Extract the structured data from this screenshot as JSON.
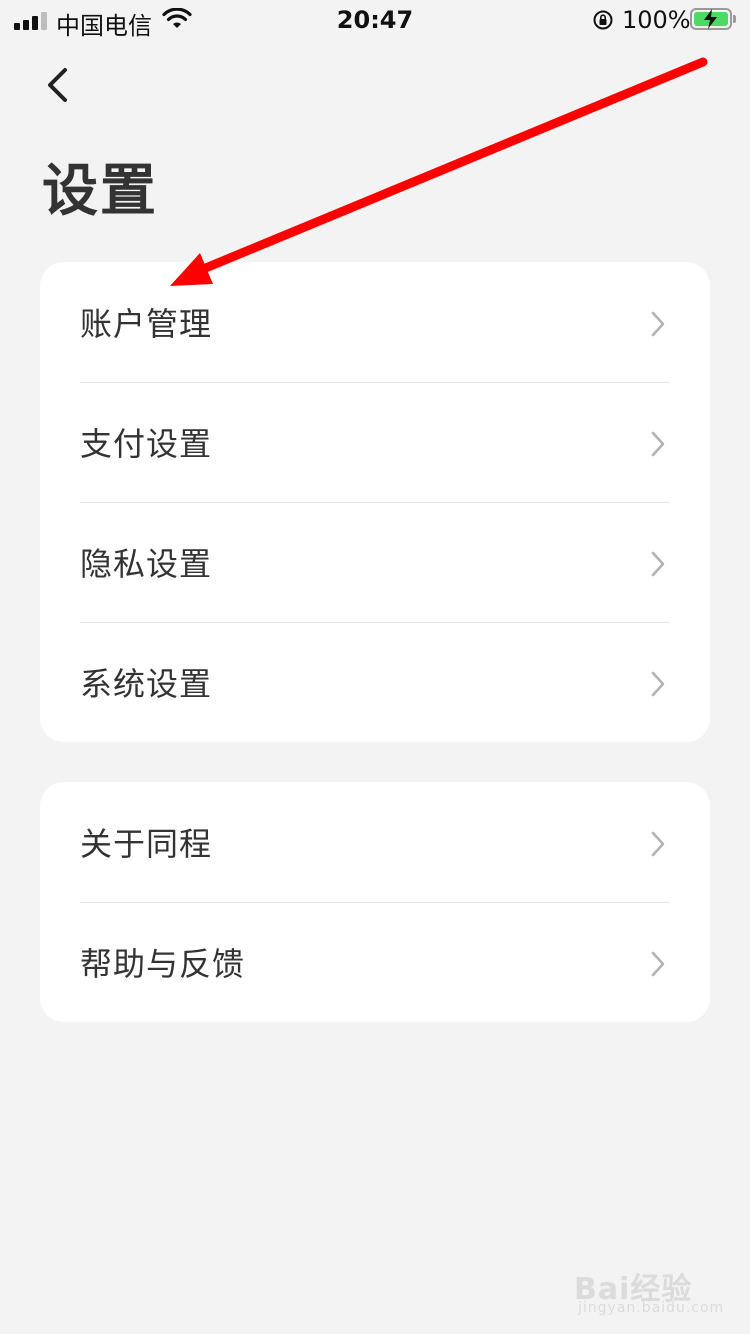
{
  "status_bar": {
    "carrier": "中国电信",
    "time": "20:47",
    "battery_percent": "100%",
    "battery_level": 1.0,
    "signal_bars_filled": 3,
    "icons": [
      "signal-icon",
      "wifi-icon",
      "rotation-lock-icon",
      "battery-charging-icon"
    ]
  },
  "header": {
    "back_icon": "chevron-left-icon",
    "title": "设置"
  },
  "groups": [
    {
      "items": [
        {
          "label": "账户管理",
          "icon": "chevron-right-icon"
        },
        {
          "label": "支付设置",
          "icon": "chevron-right-icon"
        },
        {
          "label": "隐私设置",
          "icon": "chevron-right-icon"
        },
        {
          "label": "系统设置",
          "icon": "chevron-right-icon"
        }
      ]
    },
    {
      "items": [
        {
          "label": "关于同程",
          "icon": "chevron-right-icon"
        },
        {
          "label": "帮助与反馈",
          "icon": "chevron-right-icon"
        }
      ]
    }
  ],
  "annotation": {
    "type": "red-arrow",
    "color": "#ff0000",
    "points_to": "账户管理"
  },
  "watermark": {
    "text": "Bai经验",
    "sub": "jingyan.baidu.com"
  },
  "colors": {
    "background": "#f3f3f3",
    "card": "#ffffff",
    "text": "#333333",
    "chevron": "#b3b3b3",
    "battery": "#4cd964",
    "annotation": "#ff0000"
  }
}
